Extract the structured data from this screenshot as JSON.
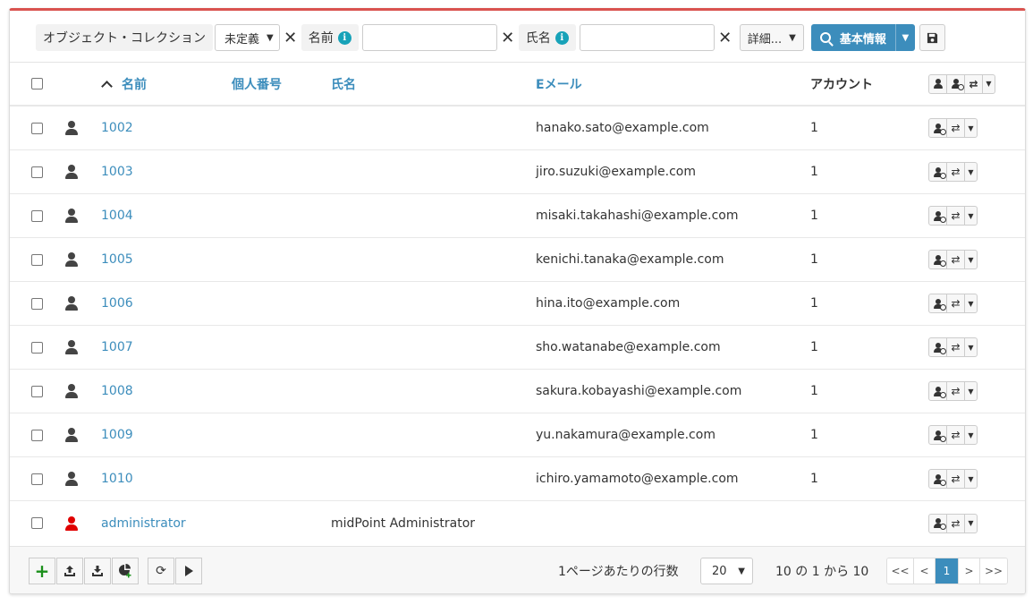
{
  "search": {
    "collection_label": "オブジェクト・コレクション",
    "collection_value": "未定義",
    "name_label": "名前",
    "fullname_label": "氏名",
    "name_value": "",
    "fullname_value": "",
    "more_label": "詳細...",
    "search_button_label": "基本情報",
    "clear_glyph": "✕",
    "info_glyph": "i"
  },
  "columns": {
    "name": "名前",
    "personal_number": "個人番号",
    "full_name": "氏名",
    "email": "Eメール",
    "accounts": "アカウント"
  },
  "rows": [
    {
      "name": "1002",
      "full_name": "",
      "email": "hanako.sato@example.com",
      "accounts": "1",
      "admin": false
    },
    {
      "name": "1003",
      "full_name": "",
      "email": "jiro.suzuki@example.com",
      "accounts": "1",
      "admin": false
    },
    {
      "name": "1004",
      "full_name": "",
      "email": "misaki.takahashi@example.com",
      "accounts": "1",
      "admin": false
    },
    {
      "name": "1005",
      "full_name": "",
      "email": "kenichi.tanaka@example.com",
      "accounts": "1",
      "admin": false
    },
    {
      "name": "1006",
      "full_name": "",
      "email": "hina.ito@example.com",
      "accounts": "1",
      "admin": false
    },
    {
      "name": "1007",
      "full_name": "",
      "email": "sho.watanabe@example.com",
      "accounts": "1",
      "admin": false
    },
    {
      "name": "1008",
      "full_name": "",
      "email": "sakura.kobayashi@example.com",
      "accounts": "1",
      "admin": false
    },
    {
      "name": "1009",
      "full_name": "",
      "email": "yu.nakamura@example.com",
      "accounts": "1",
      "admin": false
    },
    {
      "name": "1010",
      "full_name": "",
      "email": "ichiro.yamamoto@example.com",
      "accounts": "1",
      "admin": false
    },
    {
      "name": "administrator",
      "full_name": "midPoint Administrator",
      "email": "",
      "accounts": "",
      "admin": true
    }
  ],
  "footer": {
    "rows_per_page_label": "1ページあたりの行数",
    "rows_per_page_value": "20",
    "count_label": "10 の 1 から 10",
    "pager": {
      "first": "<<",
      "prev": "<",
      "current": "1",
      "next": ">",
      "last": ">>"
    }
  },
  "colors": {
    "accent": "#3c8dbc",
    "top_border": "#d9534f",
    "admin_icon": "#e00000",
    "add_icon": "#1a8f1a",
    "info_icon": "#17a2b8"
  },
  "icons": {
    "row_type": "user-icon",
    "row_actions": [
      "user-disable-icon",
      "exchange-icon",
      "caret-down-icon"
    ],
    "header_actions": [
      "user-icon",
      "user-disable-icon",
      "exchange-icon",
      "caret-down-icon"
    ],
    "footer": [
      "plus-icon",
      "upload-icon",
      "download-icon",
      "chart-add-icon",
      "refresh-icon",
      "play-icon"
    ],
    "save": "floppy-disk-icon",
    "search": "search-icon"
  }
}
